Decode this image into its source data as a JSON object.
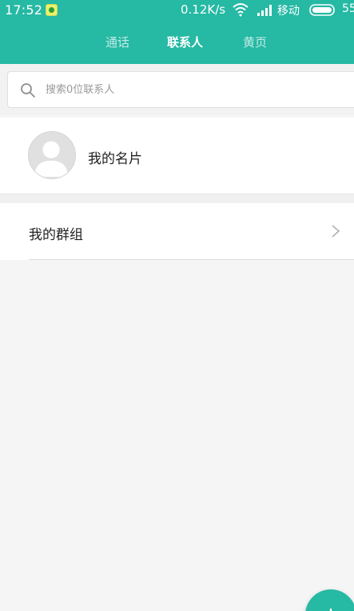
{
  "status_bar": {
    "time": "17:52",
    "app_icon": "notification-app-icon",
    "network_speed": "0.12K/s",
    "wifi_icon": "wifi-icon",
    "signal_icon": "signal-icon",
    "carrier": "移动",
    "battery_icon": "battery-icon",
    "battery_level": "55"
  },
  "tabs": [
    {
      "label": "通话",
      "active": false
    },
    {
      "label": "联系人",
      "active": true
    },
    {
      "label": "黄页",
      "active": false
    }
  ],
  "search": {
    "icon": "search-icon",
    "placeholder": "搜索0位联系人"
  },
  "my_card": {
    "label": "我的名片",
    "avatar_icon": "person-avatar-icon"
  },
  "groups": {
    "label": "我的群组",
    "chevron_icon": "chevron-right-icon"
  },
  "fab": {
    "icon": "plus-icon"
  },
  "colors": {
    "accent": "#26b9a4",
    "background": "#f5f5f5"
  }
}
